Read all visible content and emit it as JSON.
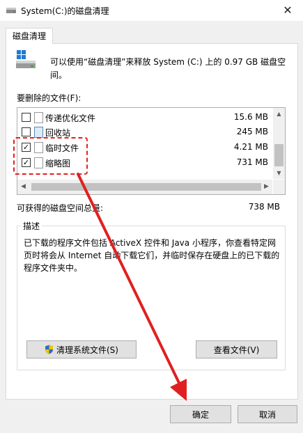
{
  "window": {
    "title": "System(C:)的磁盘清理",
    "close_glyph": "✕"
  },
  "tab": {
    "label": "磁盘清理"
  },
  "intro": {
    "text": "可以使用“磁盘清理”来释放 System (C:) 上的 0.97 GB 磁盘空间。"
  },
  "files": {
    "label": "要删除的文件(F):",
    "items": [
      {
        "name": "传递优化文件",
        "size": "15.6 MB",
        "checked": false,
        "icon": "file-icon"
      },
      {
        "name": "回收站",
        "size": "245 MB",
        "checked": false,
        "icon": "recycle-bin-icon"
      },
      {
        "name": "临时文件",
        "size": "4.21 MB",
        "checked": true,
        "icon": "file-icon"
      },
      {
        "name": "缩略图",
        "size": "731 MB",
        "checked": true,
        "icon": "file-icon"
      }
    ]
  },
  "gain": {
    "label": "可获得的磁盘空间总量:",
    "value": "738 MB"
  },
  "description": {
    "title": "描述",
    "text": "已下载的程序文件包括 ActiveX 控件和 Java 小程序，你查看特定网页时将会从 Internet 自动下载它们，并临时保存在硬盘上的已下载的程序文件夹中。"
  },
  "buttons": {
    "clean_system": "清理系统文件(S)",
    "view_files": "查看文件(V)",
    "ok": "确定",
    "cancel": "取消"
  },
  "colors": {
    "annotation_red": "#e02020"
  }
}
